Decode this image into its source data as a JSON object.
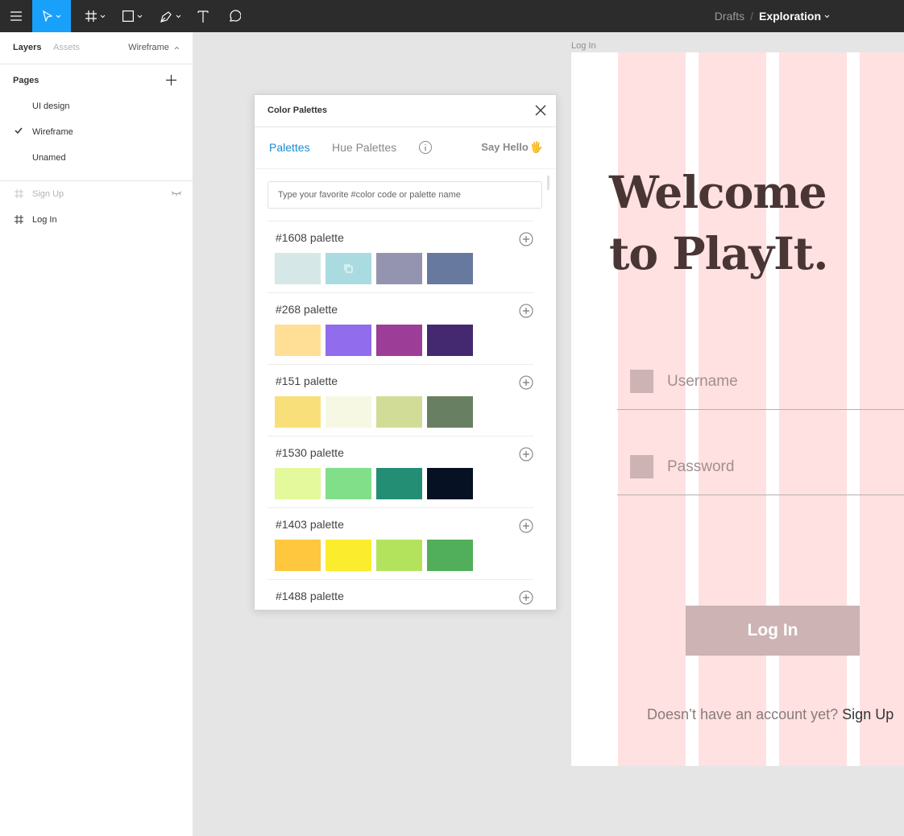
{
  "toolbar": {
    "breadcrumb_project": "Drafts",
    "breadcrumb_separator": "/",
    "breadcrumb_file": "Exploration",
    "tools": [
      "menu-icon",
      "move-icon",
      "frame-icon",
      "rectangle-icon",
      "pen-icon",
      "text-icon",
      "comment-icon"
    ],
    "active_color": "#18a0fb"
  },
  "left_panel": {
    "tab_layers": "Layers",
    "tab_assets": "Assets",
    "current_page": "Wireframe",
    "pages_title": "Pages",
    "pages": [
      {
        "label": "UI design",
        "selected": false
      },
      {
        "label": "Wireframe",
        "selected": true
      },
      {
        "label": "Unamed",
        "selected": false
      }
    ],
    "layers": [
      {
        "label": "Sign Up",
        "hidden": true
      },
      {
        "label": "Log In",
        "hidden": false
      }
    ]
  },
  "canvas": {
    "frame_label": "Log In",
    "welcome_line1": "Welcome",
    "welcome_line2": "to PlayIt.",
    "username_placeholder": "Username",
    "password_placeholder": "Password",
    "login_button": "Log In",
    "signup_question": "Doesn’t have an account yet?",
    "signup_link": "Sign Up",
    "colors": {
      "column": "#ffe1e1",
      "heading": "#4a3535",
      "button": "#cdb3b3"
    }
  },
  "plugin": {
    "title": "Color Palettes",
    "tab_palettes": "Palettes",
    "tab_hue": "Hue Palettes",
    "say_hello": "Say Hello",
    "say_hello_emoji": "🖐",
    "search_placeholder": "Type your favorite #color code or palette name",
    "palettes": [
      {
        "name": "#1608 palette",
        "colors": [
          "#d5e8e7",
          "#a9dbe0",
          "#9594b0",
          "#68799f"
        ]
      },
      {
        "name": "#268 palette",
        "colors": [
          "#fedf95",
          "#916cec",
          "#9c3d98",
          "#452970"
        ]
      },
      {
        "name": "#151 palette",
        "colors": [
          "#f9df7a",
          "#f6f8e3",
          "#d1dd96",
          "#688061"
        ]
      },
      {
        "name": "#1530 palette",
        "colors": [
          "#e3f99c",
          "#81df8a",
          "#238e73",
          "#061224"
        ]
      },
      {
        "name": "#1403 palette",
        "colors": [
          "#fec73d",
          "#fbec2e",
          "#b3e35d",
          "#51ae5a"
        ]
      },
      {
        "name": "#1488 palette",
        "colors": [
          "#f0f0f0",
          "#f0f0f0",
          "#f0f0f0",
          "#f0f0f0"
        ]
      }
    ]
  }
}
